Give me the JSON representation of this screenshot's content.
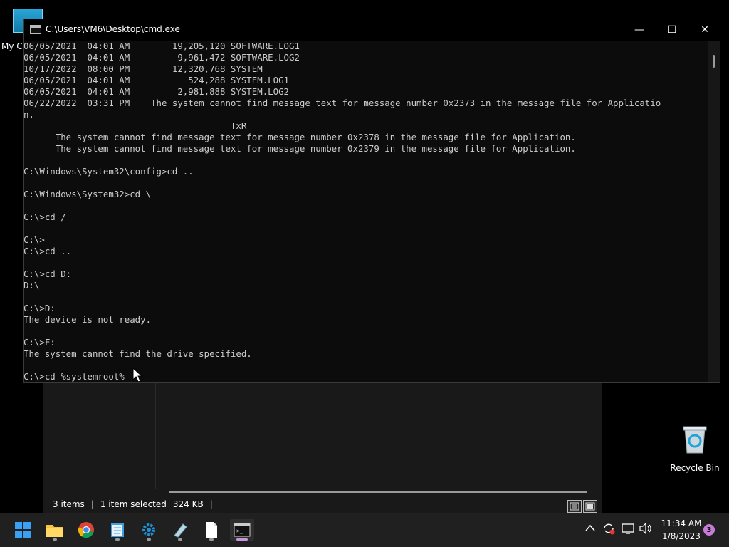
{
  "desktop": {
    "my_computer_label": "My Co",
    "recycle_bin_label": "Recycle Bin"
  },
  "explorer": {
    "status_items": "3 items",
    "status_selected": "1 item selected",
    "status_size": "324 KB",
    "separator": "|"
  },
  "cmd": {
    "title": "C:\\Users\\VM6\\Desktop\\cmd.exe",
    "lines": [
      "06/05/2021  04:01 AM        19,205,120 SOFTWARE.LOG1",
      "06/05/2021  04:01 AM         9,961,472 SOFTWARE.LOG2",
      "10/17/2022  08:00 PM        12,320,768 SYSTEM",
      "06/05/2021  04:01 AM           524,288 SYSTEM.LOG1",
      "06/05/2021  04:01 AM         2,981,888 SYSTEM.LOG2",
      "06/22/2022  03:31 PM    The system cannot find message text for message number 0x2373 in the message file for Applicatio",
      "n.",
      "                                       TxR",
      "      The system cannot find message text for message number 0x2378 in the message file for Application.",
      "      The system cannot find message text for message number 0x2379 in the message file for Application.",
      "",
      "C:\\Windows\\System32\\config>cd ..",
      "",
      "C:\\Windows\\System32>cd \\",
      "",
      "C:\\>cd /",
      "",
      "C:\\>",
      "C:\\>cd ..",
      "",
      "C:\\>cd D:",
      "D:\\",
      "",
      "C:\\>D:",
      "The device is not ready.",
      "",
      "C:\\>F:",
      "The system cannot find the drive specified.",
      "",
      "C:\\>cd %systemroot%"
    ],
    "minimize_glyph": "—",
    "maximize_glyph": "☐",
    "close_glyph": "✕"
  },
  "taskbar": {
    "apps": [
      {
        "name": "start-icon"
      },
      {
        "name": "file-explorer-icon"
      },
      {
        "name": "chrome-icon"
      },
      {
        "name": "notepad-icon"
      },
      {
        "name": "settings-gear-icon"
      },
      {
        "name": "paint-icon"
      },
      {
        "name": "document-icon"
      },
      {
        "name": "terminal-icon"
      }
    ],
    "tray_chevron": "^",
    "time": "11:34 AM",
    "date": "1/8/2023",
    "notification_count": "3"
  },
  "colors": {
    "cmd_text": "#cccccc",
    "cmd_background": "#0c0c0c",
    "taskbar": "#202020",
    "accent": "#c996d8"
  }
}
